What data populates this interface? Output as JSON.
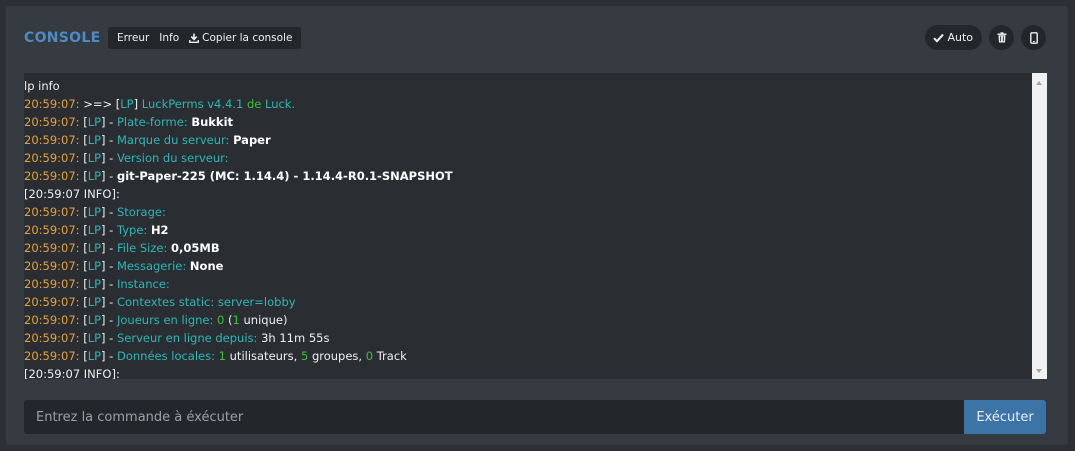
{
  "header": {
    "title": "CONSOLE",
    "filters": {
      "error": "Erreur",
      "info": "Info",
      "copy": "Copier la console"
    },
    "auto_label": "Auto",
    "icons": {
      "copy": "download-icon",
      "auto": "check-icon",
      "trash": "trash-icon",
      "mobile": "mobile-icon"
    }
  },
  "colors": {
    "timestamp": "#e6a23c",
    "cyan": "#2fb6b6",
    "green": "#3fbf3f",
    "accent": "#4e8bc4",
    "button": "#3d74a8"
  },
  "console": {
    "lines": [
      [
        {
          "t": "lp info",
          "c": "wh"
        }
      ],
      [
        {
          "t": "20:59:07: ",
          "c": "ts"
        },
        {
          "t": ">=> ",
          "c": "wh"
        },
        {
          "t": "[",
          "c": "wh"
        },
        {
          "t": "LP",
          "c": "lp"
        },
        {
          "t": "] ",
          "c": "wh"
        },
        {
          "t": "LuckPerms v4.4.1 ",
          "c": "cy"
        },
        {
          "t": "de ",
          "c": "gr"
        },
        {
          "t": "Luck.",
          "c": "cy"
        }
      ],
      [
        {
          "t": "20:59:07: ",
          "c": "ts"
        },
        {
          "t": "[",
          "c": "wh"
        },
        {
          "t": "LP",
          "c": "lp"
        },
        {
          "t": "] - ",
          "c": "wh"
        },
        {
          "t": "Plate-forme: ",
          "c": "cy"
        },
        {
          "t": "Bukkit",
          "c": "wb"
        }
      ],
      [
        {
          "t": "20:59:07: ",
          "c": "ts"
        },
        {
          "t": "[",
          "c": "wh"
        },
        {
          "t": "LP",
          "c": "lp"
        },
        {
          "t": "] - ",
          "c": "wh"
        },
        {
          "t": "Marque du serveur: ",
          "c": "cy"
        },
        {
          "t": "Paper",
          "c": "wb"
        }
      ],
      [
        {
          "t": "20:59:07: ",
          "c": "ts"
        },
        {
          "t": "[",
          "c": "wh"
        },
        {
          "t": "LP",
          "c": "lp"
        },
        {
          "t": "] - ",
          "c": "wh"
        },
        {
          "t": "Version du serveur:",
          "c": "cy"
        }
      ],
      [
        {
          "t": "20:59:07: ",
          "c": "ts"
        },
        {
          "t": "[",
          "c": "wh"
        },
        {
          "t": "LP",
          "c": "lp"
        },
        {
          "t": "] - ",
          "c": "wh"
        },
        {
          "t": "git-Paper-225 (MC: 1.14.4) - 1.14.4-R0.1-SNAPSHOT",
          "c": "wb"
        }
      ],
      [
        {
          "t": "[20:59:07 INFO]:",
          "c": "wh"
        }
      ],
      [
        {
          "t": "20:59:07: ",
          "c": "ts"
        },
        {
          "t": "[",
          "c": "wh"
        },
        {
          "t": "LP",
          "c": "lp"
        },
        {
          "t": "] - ",
          "c": "wh"
        },
        {
          "t": "Storage:",
          "c": "cy"
        }
      ],
      [
        {
          "t": "20:59:07: ",
          "c": "ts"
        },
        {
          "t": "[",
          "c": "wh"
        },
        {
          "t": "LP",
          "c": "lp"
        },
        {
          "t": "] - ",
          "c": "wh"
        },
        {
          "t": "Type: ",
          "c": "cy"
        },
        {
          "t": "H2",
          "c": "wb"
        }
      ],
      [
        {
          "t": "20:59:07: ",
          "c": "ts"
        },
        {
          "t": "[",
          "c": "wh"
        },
        {
          "t": "LP",
          "c": "lp"
        },
        {
          "t": "] - ",
          "c": "wh"
        },
        {
          "t": "File Size: ",
          "c": "cy"
        },
        {
          "t": "0,05MB",
          "c": "wb"
        }
      ],
      [
        {
          "t": "20:59:07: ",
          "c": "ts"
        },
        {
          "t": "[",
          "c": "wh"
        },
        {
          "t": "LP",
          "c": "lp"
        },
        {
          "t": "] - ",
          "c": "wh"
        },
        {
          "t": "Messagerie: ",
          "c": "cy"
        },
        {
          "t": "None",
          "c": "wb"
        }
      ],
      [
        {
          "t": "20:59:07: ",
          "c": "ts"
        },
        {
          "t": "[",
          "c": "wh"
        },
        {
          "t": "LP",
          "c": "lp"
        },
        {
          "t": "] - ",
          "c": "wh"
        },
        {
          "t": "Instance:",
          "c": "cy"
        }
      ],
      [
        {
          "t": "20:59:07: ",
          "c": "ts"
        },
        {
          "t": "[",
          "c": "wh"
        },
        {
          "t": "LP",
          "c": "lp"
        },
        {
          "t": "] - ",
          "c": "wh"
        },
        {
          "t": "Contextes static: ",
          "c": "cy"
        },
        {
          "t": "server=",
          "c": "cy"
        },
        {
          "t": "lobby",
          "c": "cy"
        }
      ],
      [
        {
          "t": "20:59:07: ",
          "c": "ts"
        },
        {
          "t": "[",
          "c": "wh"
        },
        {
          "t": "LP",
          "c": "lp"
        },
        {
          "t": "] - ",
          "c": "wh"
        },
        {
          "t": "Joueurs en ligne: ",
          "c": "cy"
        },
        {
          "t": "0",
          "c": "gr"
        },
        {
          "t": " (",
          "c": "wh"
        },
        {
          "t": "1",
          "c": "gr"
        },
        {
          "t": " unique)",
          "c": "wh"
        }
      ],
      [
        {
          "t": "20:59:07: ",
          "c": "ts"
        },
        {
          "t": "[",
          "c": "wh"
        },
        {
          "t": "LP",
          "c": "lp"
        },
        {
          "t": "] - ",
          "c": "wh"
        },
        {
          "t": "Serveur en ligne depuis: ",
          "c": "cy"
        },
        {
          "t": "3h 11m 55s",
          "c": "wh"
        }
      ],
      [
        {
          "t": "20:59:07: ",
          "c": "ts"
        },
        {
          "t": "[",
          "c": "wh"
        },
        {
          "t": "LP",
          "c": "lp"
        },
        {
          "t": "] - ",
          "c": "wh"
        },
        {
          "t": "Données locales: ",
          "c": "cy"
        },
        {
          "t": "1",
          "c": "gr"
        },
        {
          "t": " utilisateurs, ",
          "c": "wh"
        },
        {
          "t": "5",
          "c": "gr"
        },
        {
          "t": " groupes, ",
          "c": "wh"
        },
        {
          "t": "0",
          "c": "gr"
        },
        {
          "t": " Track",
          "c": "wh"
        }
      ],
      [
        {
          "t": "[20:59:07 INFO]:",
          "c": "wh"
        }
      ]
    ]
  },
  "command": {
    "placeholder": "Entrez la commande à éxécuter",
    "value": "",
    "submit_label": "Exécuter"
  }
}
